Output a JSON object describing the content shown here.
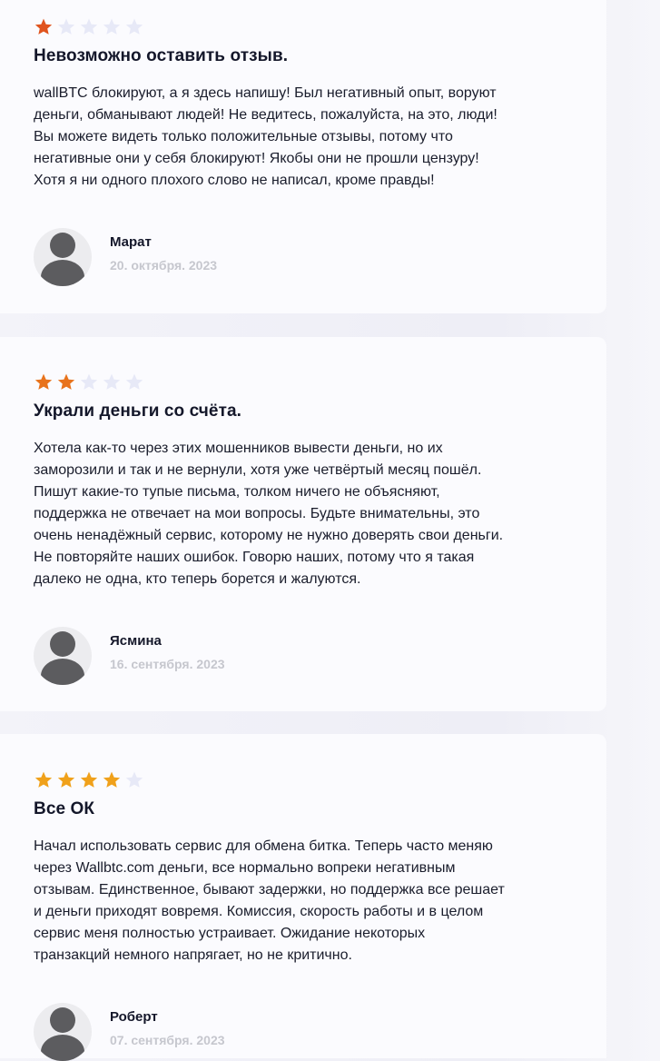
{
  "colors": {
    "star_low": "#e0541e",
    "star_mid": "#e8731c",
    "star_high": "#f0a11b",
    "star_empty": "#e7e9f7",
    "card_bg": "#fbfbfe",
    "date_text": "#c6c7ce"
  },
  "reviews": [
    {
      "rating": 1,
      "max_rating": 5,
      "title": "Невозможно оставить отзыв.",
      "text": "wallBTC блокируют, а я здесь напишу! Был негативный опыт, воруют\nденьги, обманывают людей! Не ведитесь, пожалуйста, на это, люди!\nВы можете видеть только положительные отзывы, потому что\nнегативные они у себя блокируют! Якобы они не прошли цензуру!\nХотя я ни одного плохого слово не написал, кроме правды!",
      "author": "Марат",
      "date": "20. октября. 2023",
      "avatar_icon": "user-avatar-icon"
    },
    {
      "rating": 2,
      "max_rating": 5,
      "title": "Украли деньги со счёта.",
      "text": "Хотела как-то через этих мошенников вывести деньги, но их\nзаморозили и так и не вернули, хотя уже четвёртый месяц пошёл.\nПишут какие-то тупые письма, толком ничего не объясняют,\nподдержка не отвечает на мои вопросы. Будьте внимательны, это\nочень ненадёжный сервис, которому не нужно доверять свои деньги.\nНе повторяйте наших ошибок. Говорю наших, потому что я такая\nдалеко не одна, кто теперь борется и жалуются.",
      "author": "Ясмина",
      "date": "16. сентября. 2023",
      "avatar_icon": "user-avatar-icon"
    },
    {
      "rating": 4,
      "max_rating": 5,
      "title": "Все ОК",
      "text": "Начал использовать сервис для обмена битка. Теперь часто меняю\nчерез Wallbtc.com деньги, все нормально вопреки негативным\nотзывам. Единственное, бывают задержки, но поддержка все решает\nи деньги приходят вовремя. Комиссия, скорость работы и в целом\nсервис меня полностью устраивает. Ожидание некоторых\nтранзакций немного напрягает, но не критично.",
      "author": "Роберт",
      "date": "07. сентября. 2023",
      "avatar_icon": "user-avatar-icon"
    }
  ]
}
